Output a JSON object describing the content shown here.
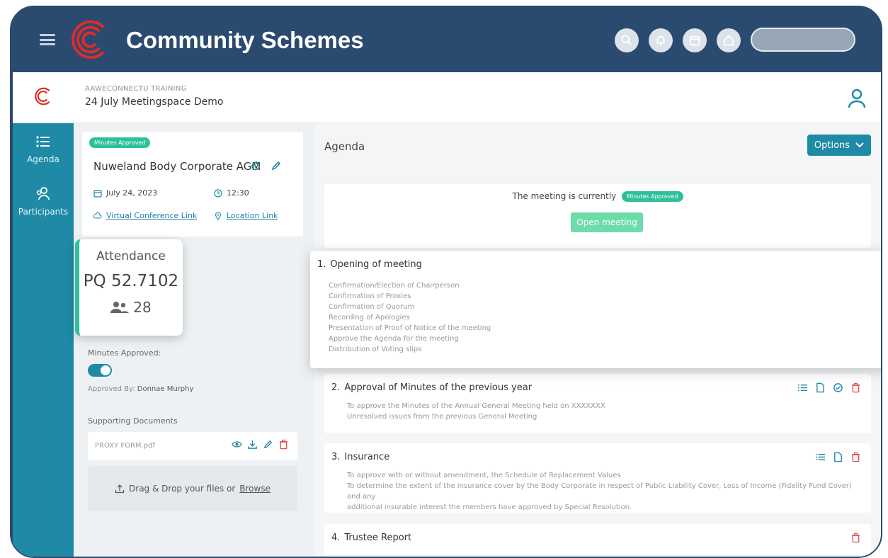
{
  "app": {
    "title": "Community Schemes"
  },
  "header": {
    "org": "AAWECONNECTU TRAINING",
    "meetingspace": "24 July Meetingspace Demo"
  },
  "sidebar": {
    "items": [
      {
        "label": "Agenda",
        "icon": "list-icon"
      },
      {
        "label": "Participants",
        "icon": "participants-icon"
      }
    ]
  },
  "meeting": {
    "badge": "Minutes Approved",
    "name": "Nuweland Body Corporate AGM",
    "date": "July 24, 2023",
    "time": "12:30",
    "virtual_link": "Virtual Conference Link",
    "location_link": "Location Link"
  },
  "attendance": {
    "title": "Attendance",
    "pq": "PQ 52.7102",
    "count": "28"
  },
  "minutes": {
    "label": "Minutes Approved:",
    "approved_by_label": "Approved By:",
    "approved_by_name": "Donnae Murphy",
    "toggle_on": true
  },
  "documents": {
    "label": "Supporting Documents",
    "files": [
      {
        "name": "PROXY FORM.pdf"
      }
    ],
    "dropzone_text": "Drag & Drop your files or",
    "browse": "Browse"
  },
  "agenda": {
    "title": "Agenda",
    "options_label": "Options",
    "status_text": "The meeting is currently",
    "status_badge": "Minutes Approved",
    "open_button": "Open meeting",
    "items": [
      {
        "number": "1.",
        "title": "Opening of meeting",
        "desc": [
          "Confirmation/Election of Chairperson",
          "Confirmation of Proxies",
          "Confirmation of Quorum",
          "Recording of Apologies",
          "Presentation of Proof of Notice of the meeting",
          "Approve the Agenda for the meeting",
          "Distribution of Voting slips"
        ]
      },
      {
        "number": "2.",
        "title": "Approval of Minutes of the previous year",
        "desc": [
          "To approve the Minutes of the Annual General Meeting held on XXXXXXX",
          "Unresolved issues from the previous General Meeting"
        ]
      },
      {
        "number": "3.",
        "title": "Insurance",
        "desc": [
          "To approve with or without amendment, the Schedule of Replacement Values",
          "To determine the extent of the insurance cover by the Body Corporate in respect of Public Liability Cover, Loss of Income (Fidelity Fund Cover) and any",
          "additional insurable interest the members have approved by Special Resolution."
        ]
      },
      {
        "number": "4.",
        "title": "Trustee Report",
        "desc": []
      }
    ]
  },
  "colors": {
    "topbar": "#2b4a6f",
    "sidenav": "#1f8aa6",
    "badge": "#2cc19a",
    "logo_red": "#e02b2b",
    "danger": "#e04b4b"
  }
}
